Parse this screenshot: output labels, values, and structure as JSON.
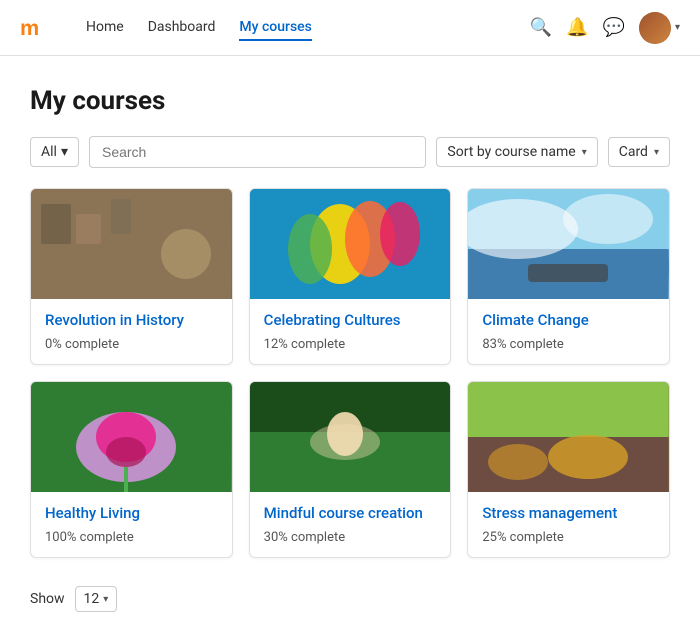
{
  "navbar": {
    "brand": "moodle",
    "links": [
      {
        "label": "Home",
        "active": false
      },
      {
        "label": "Dashboard",
        "active": false
      },
      {
        "label": "My courses",
        "active": true
      }
    ],
    "actions": {
      "search_icon": "🔍",
      "bell_icon": "🔔",
      "chat_icon": "💬",
      "chevron": "▾"
    }
  },
  "page": {
    "title": "My courses"
  },
  "toolbar": {
    "filter": {
      "value": "All",
      "chevron": "▾"
    },
    "search": {
      "placeholder": "Search",
      "value": ""
    },
    "sort": {
      "value": "Sort by course name",
      "chevron": "▾"
    },
    "view": {
      "value": "Card",
      "chevron": "▾"
    }
  },
  "courses": [
    {
      "id": 1,
      "name": "Revolution in History",
      "progress": "0% complete",
      "thumb_class": "thumb-history"
    },
    {
      "id": 2,
      "name": "Celebrating Cultures",
      "progress": "12% complete",
      "thumb_class": "thumb-cultures"
    },
    {
      "id": 3,
      "name": "Climate Change",
      "progress": "83% complete",
      "thumb_class": "thumb-climate"
    },
    {
      "id": 4,
      "name": "Healthy Living",
      "progress": "100% complete",
      "thumb_class": "thumb-living"
    },
    {
      "id": 5,
      "name": "Mindful course creation",
      "progress": "30% complete",
      "thumb_class": "thumb-mindful"
    },
    {
      "id": 6,
      "name": "Stress management",
      "progress": "25% complete",
      "thumb_class": "thumb-stress"
    }
  ],
  "pagination": {
    "show_label": "Show",
    "per_page": "12",
    "chevron": "▾"
  }
}
